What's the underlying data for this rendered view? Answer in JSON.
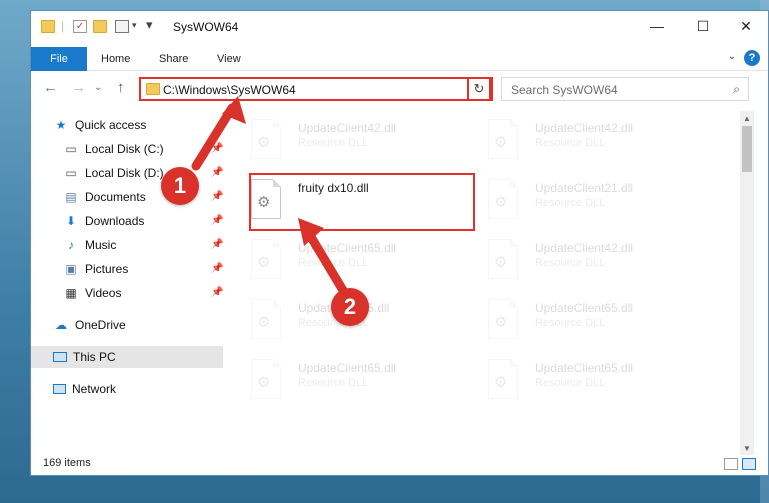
{
  "window": {
    "title": "SysWOW64",
    "controls": {
      "minimize": "—",
      "maximize": "☐",
      "close": "✕"
    }
  },
  "ribbon": {
    "tabs": [
      "File",
      "Home",
      "Share",
      "View"
    ],
    "help": "?",
    "collapse": "⌄"
  },
  "address": {
    "path": "C:\\Windows\\SysWOW64",
    "dropdown": "⌄",
    "refresh": "↻"
  },
  "search": {
    "placeholder": "Search SysWOW64",
    "icon": "⌕"
  },
  "nav": {
    "back": "←",
    "forward": "→",
    "recent": "⌄",
    "up": "↑",
    "items": [
      {
        "label": "Quick access",
        "icon": "star-icon",
        "glyph": "★",
        "color": "#1979ca"
      },
      {
        "label": "Local Disk (C:)",
        "icon": "drive-icon",
        "glyph": "▭",
        "color": "#555555"
      },
      {
        "label": "Local Disk (D:)",
        "icon": "drive-icon",
        "glyph": "▭",
        "color": "#555555"
      },
      {
        "label": "Documents",
        "icon": "documents-icon",
        "glyph": "▤",
        "color": "#5a7fa6"
      },
      {
        "label": "Downloads",
        "icon": "downloads-icon",
        "glyph": "⬇",
        "color": "#1979ca"
      },
      {
        "label": "Music",
        "icon": "music-icon",
        "glyph": "♪",
        "color": "#1979ca"
      },
      {
        "label": "Pictures",
        "icon": "pictures-icon",
        "glyph": "▣",
        "color": "#5a7fa6"
      },
      {
        "label": "Videos",
        "icon": "videos-icon",
        "glyph": "▦",
        "color": "#333333"
      },
      {
        "label": "OneDrive",
        "icon": "cloud-icon",
        "glyph": "☁",
        "color": "#1979ca"
      },
      {
        "label": "This PC",
        "icon": "computer-icon",
        "glyph": "▭",
        "color": "#1979ca"
      },
      {
        "label": "Network",
        "icon": "network-icon",
        "glyph": "▭",
        "color": "#1979ca"
      }
    ],
    "pin": "📌"
  },
  "files": [
    {
      "name": "UpdateClient42.dll",
      "type": "Resource DLL",
      "faded": true
    },
    {
      "name": "UpdateClient42.dll",
      "type": "Resource DLL",
      "faded": true
    },
    {
      "name": "fruity dx10.dll",
      "type": "",
      "faded": false
    },
    {
      "name": "UpdateClient21.dll",
      "type": "Resource DLL",
      "faded": true
    },
    {
      "name": "UpdateClient65.dll",
      "type": "Resource DLL",
      "faded": true
    },
    {
      "name": "UpdateClient42.dll",
      "type": "Resource DLL",
      "faded": true
    },
    {
      "name": "UpdateClient5.dll",
      "type": "Resource DLL",
      "faded": true
    },
    {
      "name": "UpdateClient65.dll",
      "type": "Resource DLL",
      "faded": true
    },
    {
      "name": "UpdateClient65.dll",
      "type": "Resource DLL",
      "faded": true
    },
    {
      "name": "UpdateClient65.dll",
      "type": "Resource DLL",
      "faded": true
    }
  ],
  "status": {
    "count": "169 items"
  },
  "annotations": {
    "step1": "1",
    "step2": "2",
    "accent": "#d9322a"
  }
}
